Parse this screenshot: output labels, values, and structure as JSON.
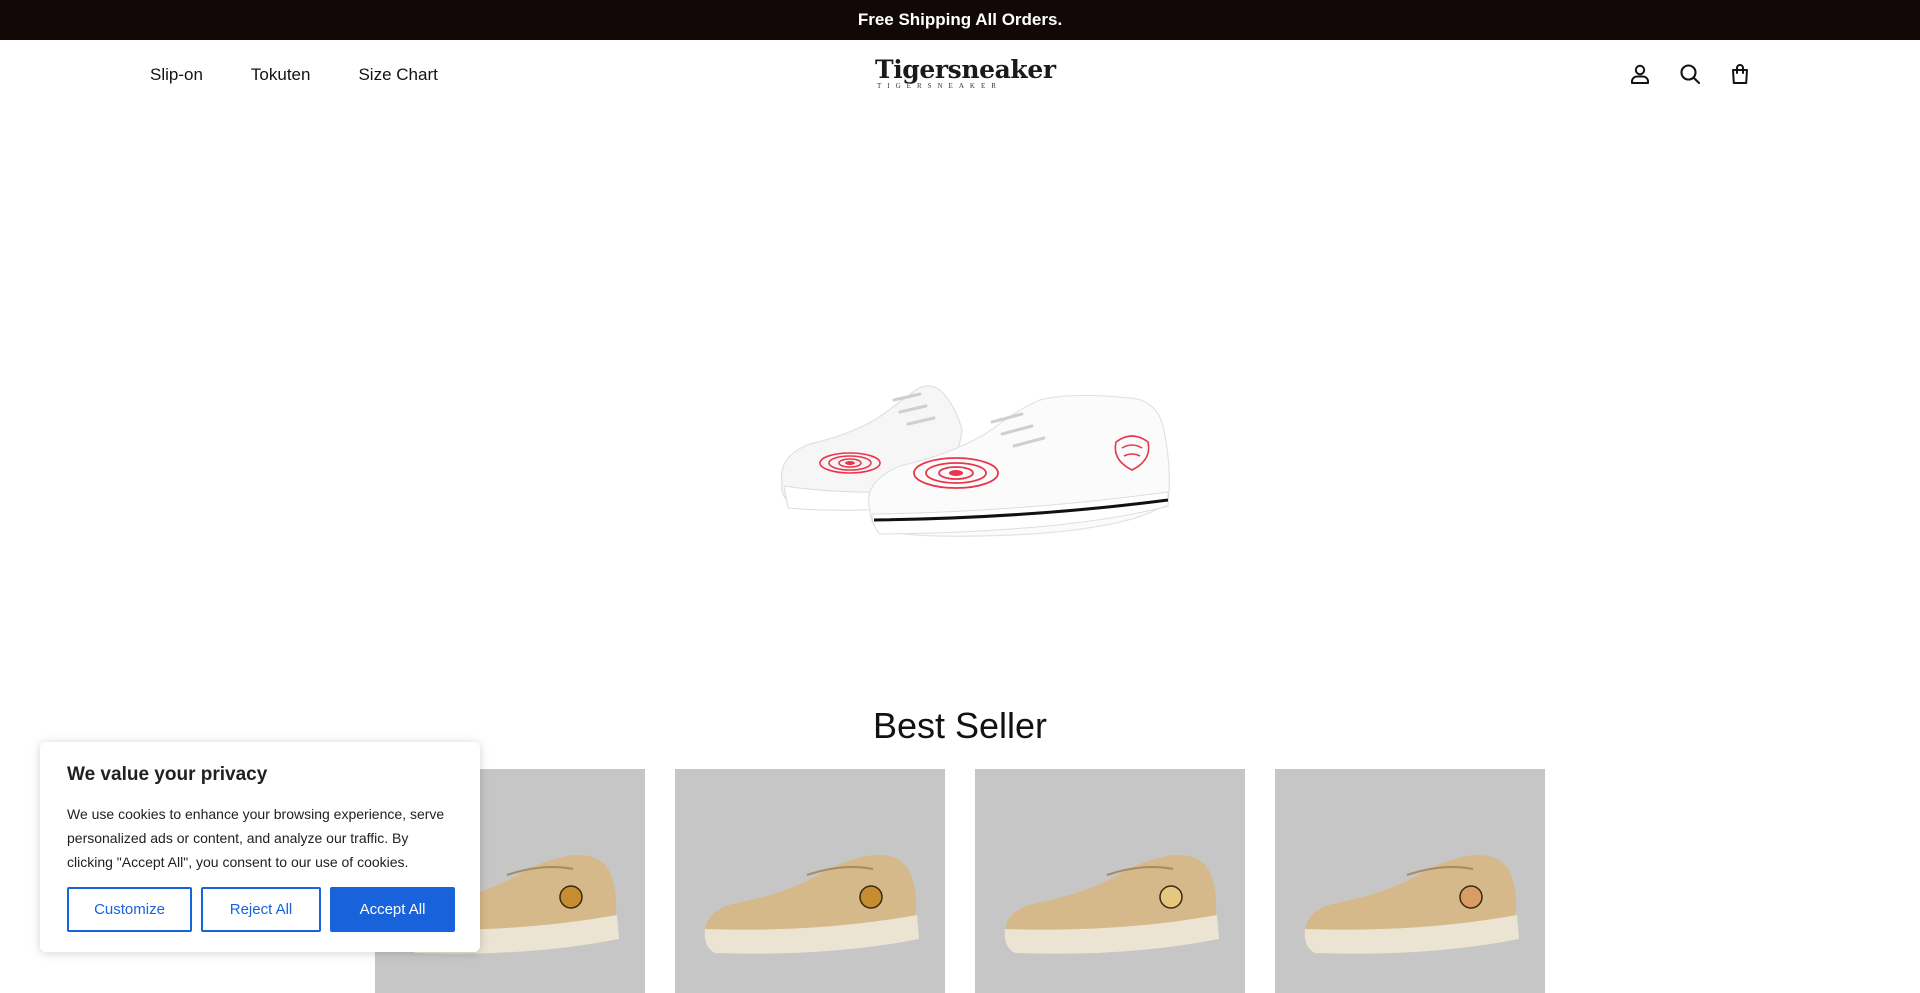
{
  "announcement": {
    "text": "Free Shipping All Orders."
  },
  "nav": {
    "items": [
      "Slip-on",
      "Tokuten",
      "Size Chart"
    ]
  },
  "logo": {
    "name": "Tigersneaker",
    "tagline": "TIGERSNEAKER"
  },
  "header_icons": [
    "account-icon",
    "search-icon",
    "cart-icon"
  ],
  "hero": {
    "image": "white low-top sneakers with red tiger print"
  },
  "best_seller": {
    "title": "Best Seller",
    "products": [
      {
        "image": "tan slip-on sneaker with tiger patch"
      },
      {
        "image": "tan slip-on sneaker with tiger patch"
      },
      {
        "image": "tan slip-on sneaker with tiger patch"
      },
      {
        "image": "tan slip-on sneaker with tiger patch"
      }
    ]
  },
  "cookie_banner": {
    "title": "We value your privacy",
    "text": "We use cookies to enhance your browsing experience, serve personalized ads or content, and analyze our traffic. By clicking \"Accept All\", you consent to our use of cookies.",
    "customize_label": "Customize",
    "reject_label": "Reject All",
    "accept_label": "Accept All"
  },
  "colors": {
    "announcement_bg": "#120807",
    "accent": "#1863dc",
    "product_bg": "#c6c6c6"
  }
}
